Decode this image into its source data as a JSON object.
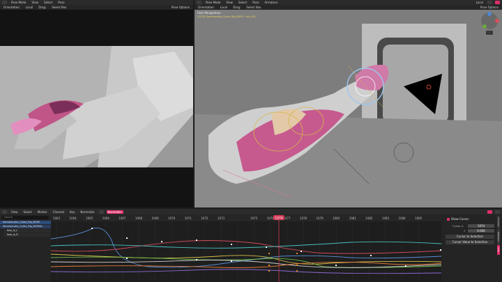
{
  "left_viewport": {
    "mode": "Pose Mode",
    "menus": [
      "View",
      "Select",
      "Pose"
    ],
    "orientation_label": "Orientation:",
    "orientation_value": "Local",
    "drag_label": "Drag:",
    "drag_value": "Select Box",
    "pose_options": "Pose Options"
  },
  "right_viewport": {
    "mode": "Pose Mode",
    "menus": [
      "View",
      "Select",
      "Pose",
      "Armature"
    ],
    "transform": "Local",
    "orientation_label": "Orientation:",
    "orientation_value": "Local",
    "drag_label": "Drag:",
    "drag_value": "Select Box",
    "pose_options": "Pose Options",
    "view_name": "User Perspective",
    "object_info": "(1074) Xenomorpha_Cyber_Rig_BODY : hair_R.R"
  },
  "graph_editor": {
    "menus": [
      "View",
      "Select",
      "Marker",
      "Channel",
      "Key",
      "Normalize"
    ],
    "normalize_label": "Normalize",
    "current_frame": "1074",
    "frame_ticks": [
      "1063",
      "1064",
      "1065",
      "1066",
      "1067",
      "1068",
      "1069",
      "1070",
      "1071",
      "1072",
      "1073",
      "1074",
      "1075",
      "1076",
      "1077",
      "1078",
      "1079",
      "1080",
      "1081",
      "1082",
      "1083",
      "1084",
      "1085"
    ],
    "search_placeholder": "Search",
    "channels": [
      "Xenomorpha_Cyber_Rig_BODY",
      "Xenomorpha_Cyber_Rig_BODYAc",
      "foot_ik_L",
      "foot_ik_R"
    ]
  },
  "sidebar": {
    "show_cursor_label": "Show Cursor",
    "cursor_x_label": "Cursor X",
    "cursor_x_value": "1074",
    "cursor_y_label": "Y",
    "cursor_y_value": "0.000",
    "cursor_to_selection": "Cursor to Selection",
    "cursor_value_to_selection": "Cursor Value to Selection",
    "tabs": [
      "F-Curve",
      "Modifiers",
      "View"
    ]
  },
  "colors": {
    "accent": "#e0306a",
    "header": "#2b2b2b",
    "graph_bg": "#1d1d1d",
    "playhead": "#d23a55"
  }
}
